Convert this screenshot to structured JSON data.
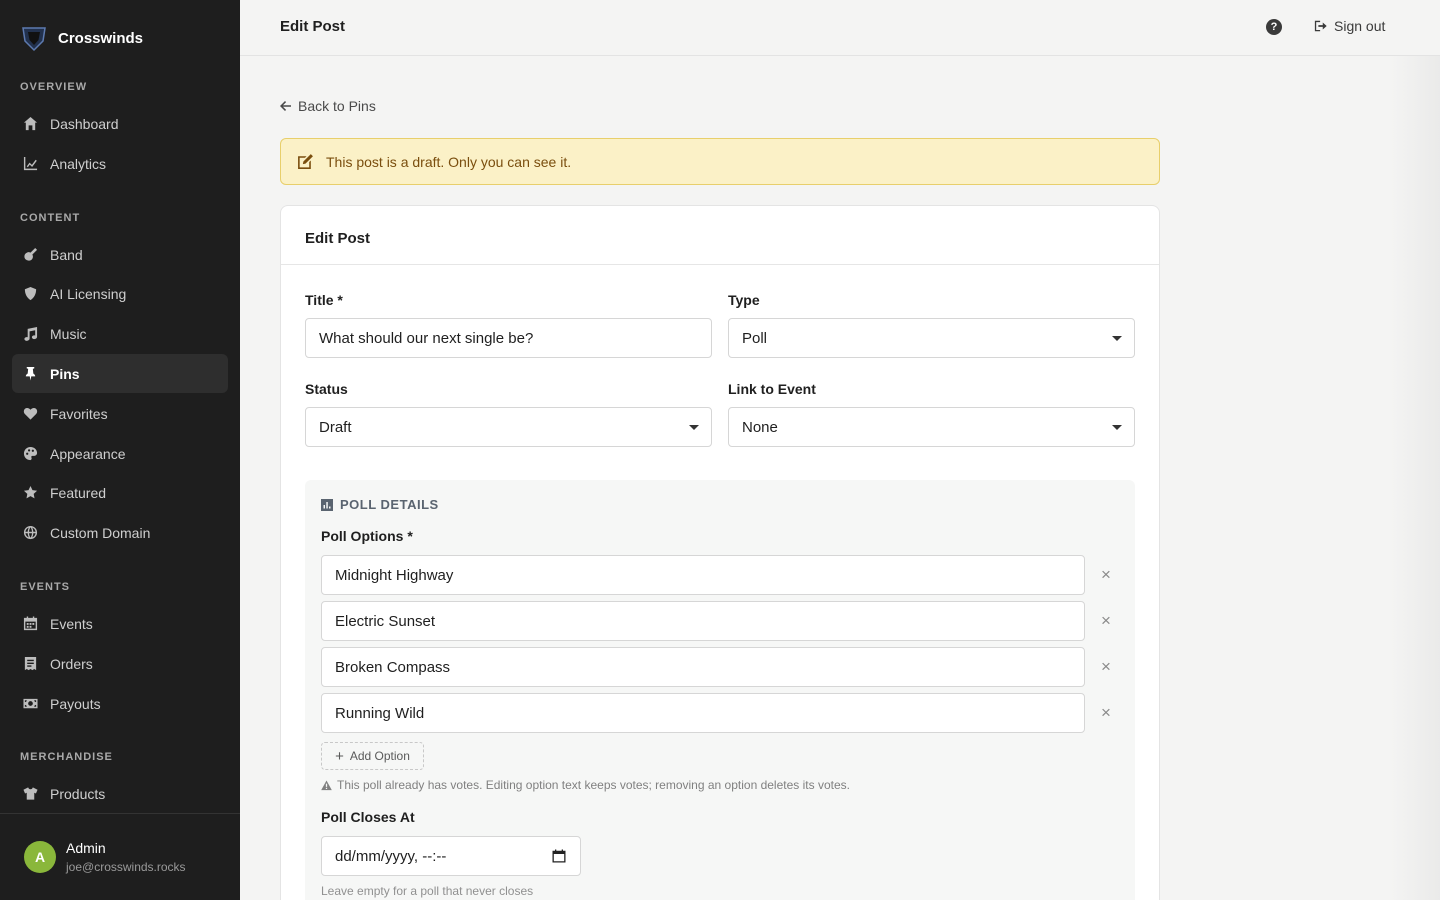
{
  "brand": {
    "name": "Crosswinds"
  },
  "sidebar": {
    "sections": [
      {
        "title": "OVERVIEW"
      },
      {
        "title": "CONTENT"
      },
      {
        "title": "EVENTS"
      },
      {
        "title": "MERCHANDISE"
      }
    ],
    "items": [
      {
        "label": "Dashboard",
        "icon": "home-icon"
      },
      {
        "label": "Analytics",
        "icon": "chart-line-icon"
      },
      {
        "label": "Band",
        "icon": "guitar-icon"
      },
      {
        "label": "AI Licensing",
        "icon": "shield-icon"
      },
      {
        "label": "Music",
        "icon": "music-icon"
      },
      {
        "label": "Pins",
        "icon": "pin-icon",
        "active": true
      },
      {
        "label": "Favorites",
        "icon": "heart-icon"
      },
      {
        "label": "Appearance",
        "icon": "palette-icon"
      },
      {
        "label": "Featured",
        "icon": "star-icon"
      },
      {
        "label": "Custom Domain",
        "icon": "globe-icon"
      },
      {
        "label": "Events",
        "icon": "calendar-icon"
      },
      {
        "label": "Orders",
        "icon": "receipt-icon"
      },
      {
        "label": "Payouts",
        "icon": "money-icon"
      },
      {
        "label": "Products",
        "icon": "shirt-icon"
      }
    ],
    "user": {
      "initial": "A",
      "name": "Admin",
      "email": "joe@crosswinds.rocks"
    }
  },
  "topbar": {
    "title": "Edit Post",
    "help": "?",
    "signout": "Sign out"
  },
  "back_link": "Back to Pins",
  "draft_banner": "This post is a draft. Only you can see it.",
  "card": {
    "title": "Edit Post",
    "fields": {
      "title_label": "Title *",
      "title_value": "What should our next single be?",
      "type_label": "Type",
      "type_value": "Poll",
      "status_label": "Status",
      "status_value": "Draft",
      "event_label": "Link to Event",
      "event_value": "None"
    },
    "poll": {
      "heading": "POLL DETAILS",
      "options_label": "Poll Options *",
      "options": [
        "Midnight Highway",
        "Electric Sunset",
        "Broken Compass",
        "Running Wild"
      ],
      "remove_symbol": "×",
      "add_option": "Add Option",
      "warning": "This poll already has votes. Editing option text keeps votes; removing an option deletes its votes.",
      "closes_label": "Poll Closes At",
      "closes_placeholder": "dd/mm/yyyy, --:--",
      "closes_hint": "Leave empty for a poll that never closes"
    }
  },
  "colors": {
    "sidebar_bg": "#1e1e1e",
    "banner_bg": "#fbf1c7",
    "banner_text": "#7a4e0e",
    "avatar": "#8ab73b"
  }
}
